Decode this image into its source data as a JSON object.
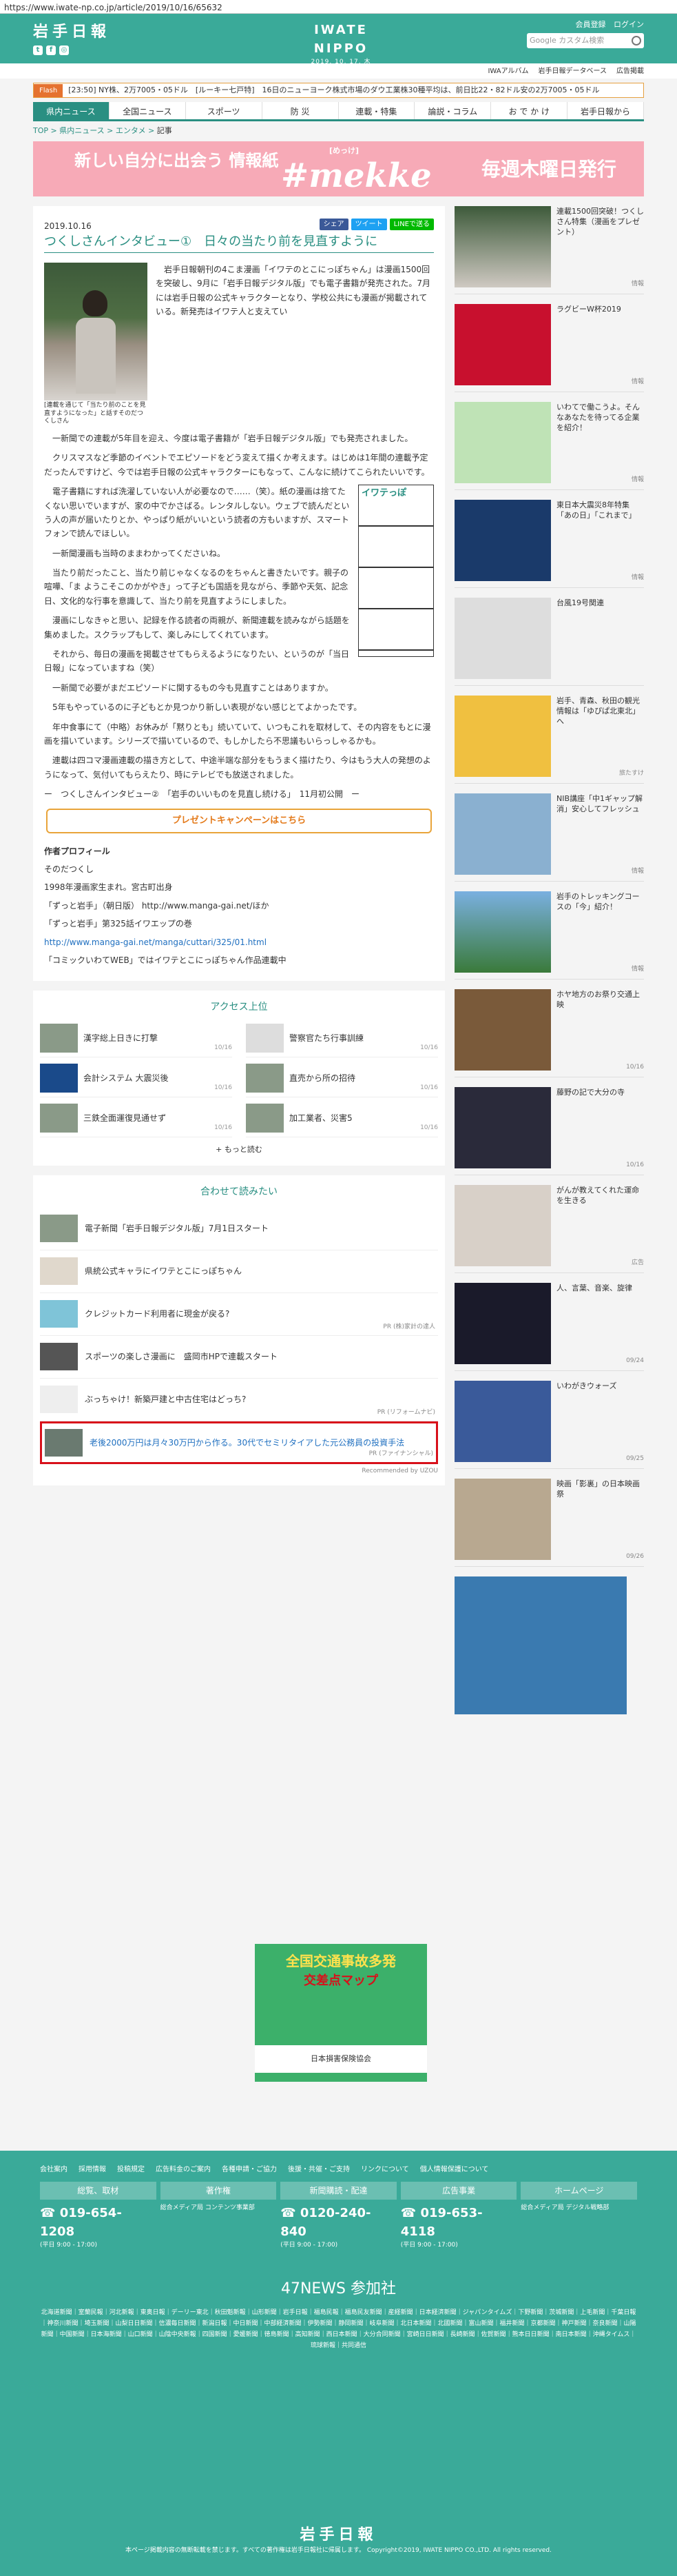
{
  "url": "https://www.iwate-np.co.jp/article/2019/10/16/65632",
  "header": {
    "logo": "岩手日報",
    "brand": "IWATE NIPPO",
    "brand_date": "2019. 10. 17. 木",
    "links": [
      "会員登録",
      "ログイン"
    ],
    "search_placeholder": "Google カスタム検索",
    "sublinks": [
      "IWAアルバム",
      "岩手日報データベース",
      "広告掲載"
    ]
  },
  "flash": {
    "tag": "Flash",
    "text": "[23:50] NY株、2万7005・05ドル　[ルーキー七戸特]　16日のニューヨーク株式市場のダウ工業株30種平均は、前日比22・82ドル安の2万7005・05ドル"
  },
  "nav": [
    "県内ニュース",
    "全国ニュース",
    "スポーツ",
    "防 災",
    "連載・特集",
    "論説・コラム",
    "お で か け",
    "岩手日報から"
  ],
  "breadcrumb": [
    "TOP",
    "県内ニュース",
    "エンタメ",
    "記事"
  ],
  "banner": {
    "left": "新しい自分に出会う 情報紙",
    "mid": "#mekke",
    "mid_small": "[めっけ]",
    "right": "毎週木曜日発行"
  },
  "article": {
    "date": "2019.10.16",
    "title": "つくしさんインタビュー①　日々の当たり前を見直すように",
    "share": [
      "シェア",
      "ツイート",
      "LINEで送る"
    ],
    "caption": "[連載を通じて「当たり前のことを見直すようになった」と話すそのだつくしさん",
    "paras": [
      "岩手日報朝刊の4こま漫画「イワテのとこにっぽちゃん」は漫画1500回を突破し、9月に「岩手日報デジタル版」でも電子書籍が発売された。7月には岩手日報の公式キャラクターとなり、学校公共にも漫画が掲載されている。新発売はイワテ人と支えてい",
      "一新聞での連載が5年目を迎え、今度は電子書籍が「岩手日報デジタル版」でも発売されました。",
      "クリスマスなど季節のイベントでエピソードをどう変えて描くか考えます。はじめは1年間の連載予定だったんですけど、今では岩手日報の公式キャラクターにもなって、こんなに続けてこられたいいです。",
      "電子書籍にすれば洗濯していない人が必要なので……（笑）。紙の漫画は捨てたくない思いでいますが、家の中でかさばる。レンタルしない。ウェブで読んだという人の声が届いたりとか、やっぱり紙がいいという読者の方もいますが、スマートフォンで読んでほしい。",
      "一新聞漫画も当時のままわかってくださいね。",
      "当たり前だったこと、当たり前じゃなくなるのをちゃんと書きたいです。親子の喧嘩、「ま ようこそこのかがやき」って子ども国語を見ながら、季節や天気、記念日、文化的な行事を意識して、当たり前を見直すようにしました。",
      "漫画にしなきゃと思い、記録を作る読者の両親が、新聞連載を読みながら話題を集めました。スクラップもして、楽しみにしてくれています。",
      "それから、毎日の漫画を掲載させてもらえるようになりたい、というのが「当日日報」になっていますね（笑）",
      "一新聞で必要がまだエピソードに関するもの今も見直すことはありますか。",
      "5年もやっているのに子どもとか見つかり新しい表現がない感じとてよかったです。",
      "年中食事にて（中略）お休みが「黙りとも」続いていて、いつもこれを取材して、その内容をもとに漫画を描いています。シリーズで描いているので、もしかしたら不思議もいらっしゃるかも。",
      "連載は四コマ漫画連載の描き方として、中途半端な部分をもうまく描けたり、今はもう大人の発想のようになって、気付いてもらえたり、時にテレビでも放送されました。"
    ],
    "footer_line": "ー　つくしさんインタビュー②　「岩手のいいものを見直し続ける」　11月初公開　ー",
    "cta": "プレゼントキャンペーンはこちら",
    "manga_title": "イワテっぽ",
    "profile": [
      "作者プロフィール",
      "そのだつくし",
      "1998年漫画家生まれ。宮古町出身",
      "「ずっと岩手」（朝日版） http://www.manga-gai.net/ほか",
      "「ずっと岩手」第325話イワエップの巻",
      "http://www.manga-gai.net/manga/cuttari/325/01.html",
      "「コミックいわてWEB」ではイワテとこにっぽちゃん作品連載中"
    ]
  },
  "ranking": {
    "title": "アクセス上位",
    "items": [
      {
        "t": "漢字総上日きに打撃",
        "tm": "10/16"
      },
      {
        "t": "警察官たち行事訓練",
        "tm": "10/16"
      },
      {
        "t": "会計システム 大震災後",
        "tm": "10/16"
      },
      {
        "t": "直売から所の招待",
        "tm": "10/16"
      },
      {
        "t": "三鉄全面運復見通せず",
        "tm": "10/16"
      },
      {
        "t": "加工業者、災害5",
        "tm": "10/16"
      }
    ],
    "more": "もっと読む"
  },
  "related": {
    "title": "合わせて読みたい",
    "items": [
      {
        "t": "電子新聞「岩手日報デジタル版」7月1日スタート",
        "pr": ""
      },
      {
        "t": "県統公式キャラにイワテとこにっぽちゃん",
        "pr": ""
      },
      {
        "t": "クレジットカード利用者に現金が戻る?",
        "pr": "PR (株)家計の達人"
      },
      {
        "t": "スポーツの楽しさ漫画に　盛岡市HPで連載スタート",
        "pr": ""
      },
      {
        "t": "ぶっちゃけ！新築戸建と中古住宅はどっち?",
        "pr": "PR (リフォームナビ)"
      },
      {
        "t": "老後2000万円は月々30万円から作る。30代でセミリタイアした元公務員の投資手法",
        "pr": "PR (ファイナンシャル)"
      }
    ],
    "rec": "Recommended by UZOU"
  },
  "sidebar": [
    {
      "t": "連載1500回突破！つくしさん特集（漫画をプレゼント）",
      "d": "情報"
    },
    {
      "t": "ラグビーW杯2019",
      "d": "情報"
    },
    {
      "t": "いわてで働こうよ。そんなあなたを待ってる企業を紹介！",
      "d": "情報"
    },
    {
      "t": "東日本大震災8年特集「あの日」「これまで」",
      "d": "情報"
    },
    {
      "t": "台風19号関連",
      "d": ""
    },
    {
      "t": "岩手、青森、秋田の観光情報は「ゆぴぱ北東北」へ",
      "d": "旅たすけ"
    },
    {
      "t": "NIB講座「中1ギャップ解消」安心してフレッシュ",
      "d": "情報"
    },
    {
      "t": "岩手のトレッキングコースの「今」紹介！",
      "d": "情報"
    },
    {
      "t": "ホヤ地方のお祭り交通上映",
      "d": "10/16"
    },
    {
      "t": "藤野の記で大分の寺",
      "d": "10/16"
    },
    {
      "t": "がんが教えてくれた運命を生きる",
      "d": "広告"
    },
    {
      "t": "人、言葉、音楽、旋律",
      "d": "09/24"
    },
    {
      "t": "いわがきウォーズ",
      "d": "09/25"
    },
    {
      "t": "映画「影裏」の日本映画祭",
      "d": "09/26"
    }
  ],
  "ad": {
    "a1": "全国交通事故多発",
    "a2": "交差点マップ",
    "a3": "日本損害保険協会"
  },
  "footer": {
    "links": [
      "会社案内",
      "採用情報",
      "投稿規定",
      "広告料金のご案内",
      "各種申請・ご協力",
      "後援・共催・ご支持",
      "リンクについて",
      "個人情報保護について"
    ],
    "cols": [
      {
        "h": "総覧、取材",
        "tel": "019-654-1208",
        "p": "(平日 9:00 - 17:00)"
      },
      {
        "h": "著作権",
        "tel": "",
        "p": "総合メディア局 コンテンツ事業部"
      },
      {
        "h": "新聞購読・配達",
        "tel": "0120-240-840",
        "p": "(平日 9:00 - 17:00)"
      },
      {
        "h": "広告事業",
        "tel": "019-653-4118",
        "p": "(平日 9:00 - 17:00)"
      },
      {
        "h": "ホームページ",
        "tel": "",
        "p": "総合メディア局 デジタル戦略部"
      }
    ],
    "n47": "47NEWS 参加社",
    "members": "北海道新聞｜室蘭民報｜河北新報｜東奥日報｜デーリー東北｜秋田魁新報｜山形新聞｜岩手日報｜福島民報｜福島民友新聞｜産経新聞｜日本経済新聞｜ジャパンタイムズ｜下野新聞｜茨城新聞｜上毛新聞｜千葉日報｜神奈川新聞｜埼玉新聞｜山梨日日新聞｜信濃毎日新聞｜新潟日報｜中日新聞｜中部経済新聞｜伊勢新聞｜静岡新聞｜岐阜新聞｜北日本新聞｜北國新聞｜富山新聞｜福井新聞｜京都新聞｜神戸新聞｜奈良新聞｜山陽新聞｜中国新聞｜日本海新聞｜山口新聞｜山陰中央新報｜四国新聞｜愛媛新聞｜徳島新聞｜高知新聞｜西日本新聞｜大分合同新聞｜宮崎日日新聞｜長崎新聞｜佐賀新聞｜熊本日日新聞｜南日本新聞｜沖縄タイムス｜琉球新報｜共同通信",
    "logo": "岩手日報",
    "copy": "本ページ掲載内容の無断転載を禁じます。すべての著作権は岩手日報社に帰属します。 Copyright©2019, IWATE NIPPO CO.,LTD. All rights reserved."
  }
}
